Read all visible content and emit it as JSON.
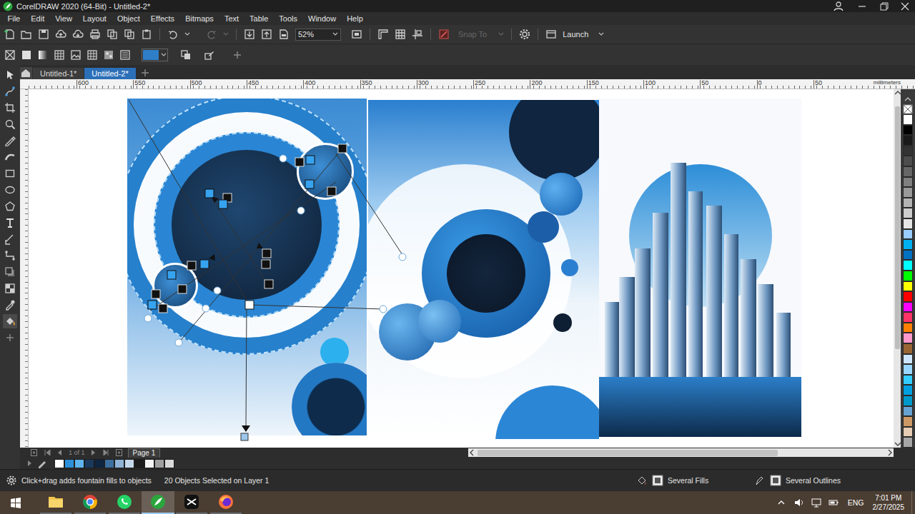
{
  "window": {
    "title": "CorelDRAW 2020 (64-Bit) - Untitled-2*"
  },
  "menu": [
    "File",
    "Edit",
    "View",
    "Layout",
    "Object",
    "Effects",
    "Bitmaps",
    "Text",
    "Table",
    "Tools",
    "Window",
    "Help"
  ],
  "standard_toolbar": {
    "zoom": "52%",
    "snap_to": {
      "label": "Snap To",
      "disabled": true
    },
    "launch": "Launch"
  },
  "property_bar": {
    "fill_color": "#2f7fc8"
  },
  "doc_tabs": [
    {
      "label": "Untitled-1*",
      "selected": false
    },
    {
      "label": "Untitled-2*",
      "selected": true
    }
  ],
  "ruler": {
    "ticks": [
      "600",
      "550",
      "500",
      "450",
      "400",
      "350",
      "300",
      "250",
      "200",
      "150",
      "100",
      "50",
      "0",
      "50"
    ],
    "unit": "millimeters"
  },
  "page_nav": {
    "count": "1 of 1",
    "page": "Page 1"
  },
  "color_palette": [
    {
      "color": "#ffffff"
    },
    {
      "color": "#000000"
    },
    {
      "color": "#1a1a1a"
    },
    {
      "color": "#333333"
    },
    {
      "color": "#4d4d4d"
    },
    {
      "color": "#666666"
    },
    {
      "color": "#808080"
    },
    {
      "color": "#999999"
    },
    {
      "color": "#b3b3b3"
    },
    {
      "color": "#cccccc"
    },
    {
      "color": "#e6e6e6"
    },
    {
      "color": "#99ccff"
    },
    {
      "color": "#00b0f0"
    },
    {
      "color": "#0070c0"
    },
    {
      "color": "#00ffff"
    },
    {
      "color": "#00ff00"
    },
    {
      "color": "#ffff00"
    },
    {
      "color": "#ff0000"
    },
    {
      "color": "#ff00ff"
    },
    {
      "color": "#ff3366"
    },
    {
      "color": "#ff8000"
    },
    {
      "color": "#ff99cc"
    },
    {
      "color": "#996633"
    },
    {
      "color": "#cce6ff"
    },
    {
      "color": "#99d6ff"
    },
    {
      "color": "#33ccff"
    },
    {
      "color": "#00a0e0"
    },
    {
      "color": "#0099cc"
    },
    {
      "color": "#66a3d2"
    },
    {
      "color": "#cc9966"
    },
    {
      "color": "#e6ccb3"
    },
    {
      "color": "#a6a6a6"
    }
  ],
  "document_palette": [
    {
      "color": "#ffffff"
    },
    {
      "color": "#2d8fd8"
    },
    {
      "color": "#5fb4ee"
    },
    {
      "color": "#1a3a5c"
    },
    {
      "color": "#0f2540"
    },
    {
      "color": "#3d6f9f"
    },
    {
      "color": "#8fb3d6"
    },
    {
      "color": "#c5d7ea"
    },
    {
      "color": "#1c1c1c"
    },
    {
      "color": "#f5f5f5"
    },
    {
      "color": "#a0a0a0"
    },
    {
      "color": "#d9d9d9"
    }
  ],
  "status_bar": {
    "hint": "Click+drag adds fountain fills to objects",
    "selection": "20 Objects Selected on Layer 1",
    "fill": "Several Fills",
    "outline": "Several Outlines"
  },
  "taskbar": {
    "apps": [
      {
        "selected": false
      },
      {
        "selected": false
      },
      {
        "selected": false
      },
      {
        "selected": true
      },
      {
        "selected": false
      },
      {
        "selected": false
      }
    ],
    "lang": "ENG",
    "time": "7:01 PM",
    "date": "2/27/2025"
  }
}
